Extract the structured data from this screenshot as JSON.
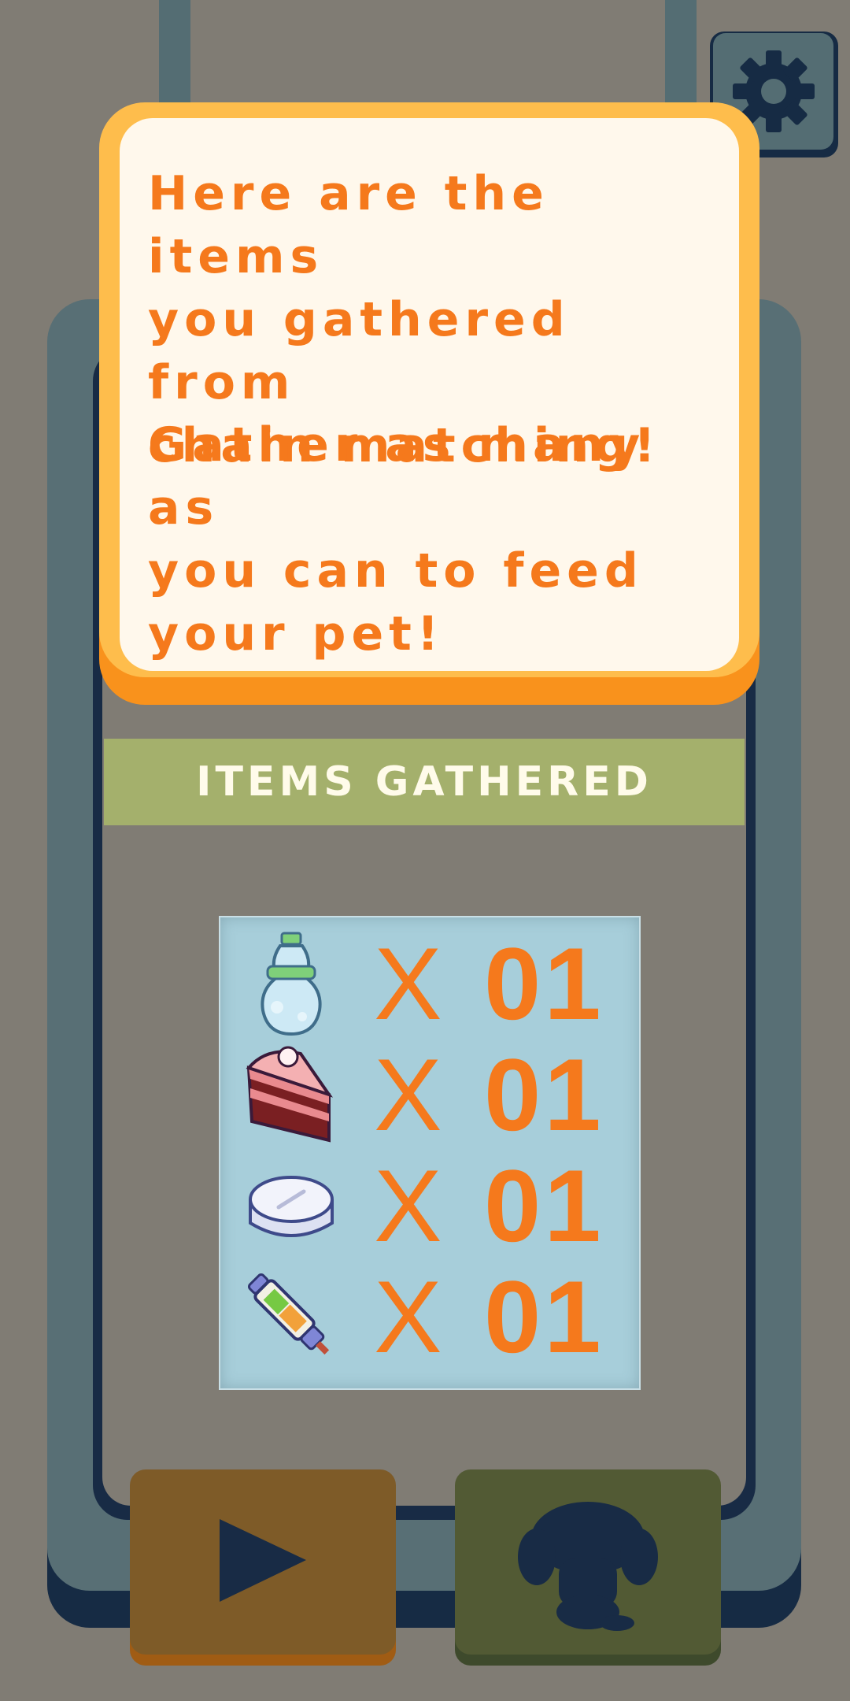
{
  "tutorial": {
    "line1": "Here are the items\nyou gathered from\nchain matching!",
    "line2": "Gather as many as\nyou can to feed\nyour pet!"
  },
  "header": {
    "label": "ITEMS GATHERED"
  },
  "items": [
    {
      "icon": "water-bottle-icon",
      "x": "X",
      "count": "01"
    },
    {
      "icon": "cake-slice-icon",
      "x": "X",
      "count": "01"
    },
    {
      "icon": "pill-tablet-icon",
      "x": "X",
      "count": "01"
    },
    {
      "icon": "syringe-pen-icon",
      "x": "X",
      "count": "01"
    }
  ],
  "buttons": {
    "settings": "gear-icon",
    "play": "play-icon",
    "pet": "pet-silhouette-icon"
  },
  "colors": {
    "accent_orange": "#f5791c",
    "bubble_border": "#febd4c",
    "header_green": "#a4b06c",
    "items_box_blue": "#a7ceda"
  }
}
